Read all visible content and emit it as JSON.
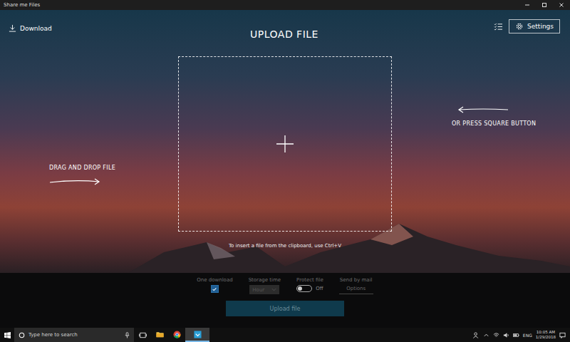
{
  "window": {
    "title": "Share me Files"
  },
  "header": {
    "download": "Download",
    "title": "UPLOAD FILE",
    "settings": "Settings"
  },
  "hints": {
    "left": "DRAG AND DROP FILE",
    "right": "OR PRESS SQUARE BUTTON",
    "clipboard": "To insert a file from the clipboard, use Ctrl+V"
  },
  "options": [
    {
      "kind": "checkbox",
      "label": "One download",
      "checked": true
    },
    {
      "kind": "select",
      "label": "Storage time",
      "value": "Hour"
    },
    {
      "kind": "toggle",
      "label": "Protect file",
      "on": false,
      "value": "Off"
    },
    {
      "kind": "link",
      "label": "Send by mail",
      "value": "Options"
    }
  ],
  "upload_button": {
    "label": "Upload file",
    "disabled": true
  },
  "taskbar": {
    "search_placeholder": "Type here to search",
    "apps": [
      {
        "kind": "explorer",
        "selected": false
      },
      {
        "kind": "chrome",
        "selected": false
      },
      {
        "kind": "share",
        "selected": true
      }
    ]
  },
  "tray": {
    "language": "ENG",
    "time": "10:05 AM",
    "date": "1/29/2018"
  }
}
